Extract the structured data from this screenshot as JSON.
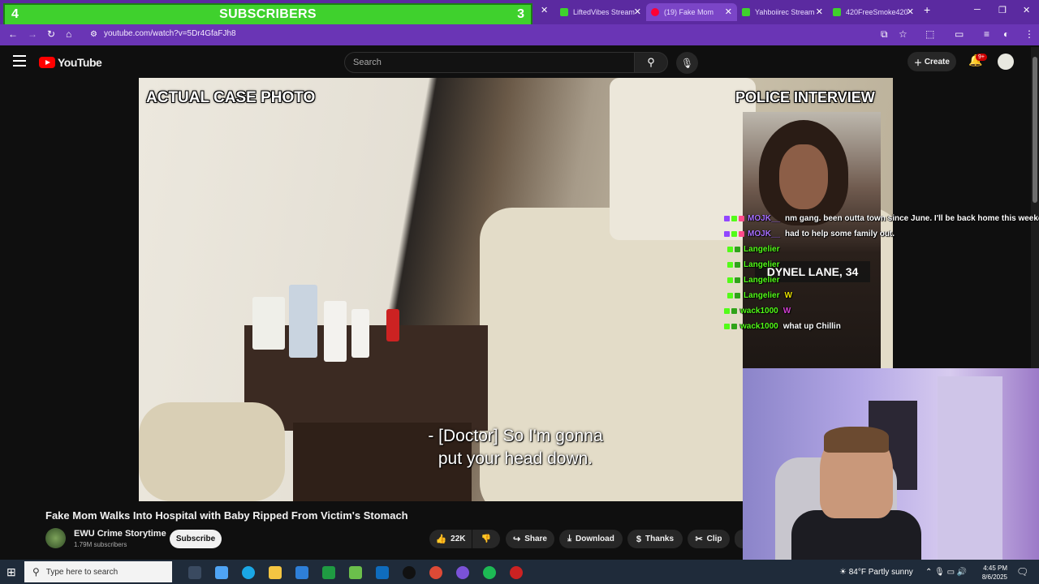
{
  "subscriber_bar": {
    "left_count": "4",
    "label": "SUBSCRIBERS",
    "right_count": "3"
  },
  "tabs": [
    {
      "title": "LiftedVibes Stream",
      "color": "#3fd12d"
    },
    {
      "title": "(19) Fake Mom",
      "color": "#ff0033"
    },
    {
      "title": "Yahboiirec Stream",
      "color": "#3fd12d"
    },
    {
      "title": "420FreeSmoke420",
      "color": "#3fd12d"
    }
  ],
  "browser": {
    "url": "youtube.com/watch?v=5Dr4GfaFJh8",
    "new_tab": "+"
  },
  "youtube": {
    "logo_text": "YouTube",
    "search_placeholder": "Search",
    "create_label": "Create",
    "notif_badge": "9+"
  },
  "video": {
    "left_label": "ACTUAL CASE PHOTO",
    "right_label": "POLICE INTERVIEW",
    "name_card": "DYNEL LANE, 34",
    "subtitle_line1": "- [Doctor] So I'm gonna",
    "subtitle_line2": "put your head down."
  },
  "chat": [
    {
      "user": "MOJK__",
      "msg": "nm gang. been outta town since June. I'll be back home this weekend",
      "color": "#a970ff"
    },
    {
      "user": "MOJK__",
      "msg": "had to help some family out.",
      "color": "#a970ff"
    },
    {
      "user": "Langelier",
      "msg": "",
      "color": "#53fc18"
    },
    {
      "user": "Langelier",
      "msg": "",
      "color": "#53fc18"
    },
    {
      "user": "Langelier",
      "msg": "",
      "color": "#53fc18"
    },
    {
      "user": "Langelier",
      "msg": "W",
      "color": "#53fc18"
    },
    {
      "user": "wack1000",
      "msg": "W",
      "color": "#53fc18"
    },
    {
      "user": "wack1000",
      "msg": "what up Chillin",
      "color": "#53fc18"
    }
  ],
  "watch": {
    "title": "Fake Mom Walks Into Hospital with Baby Ripped From Victim's Stomach",
    "channel": "EWU Crime Storytime",
    "subs": "1.79M subscribers",
    "subscribe_label": "Subscribe",
    "likes": "22K",
    "share_label": "Share",
    "download_label": "Download",
    "thanks_label": "Thanks",
    "clip_label": "Clip"
  },
  "taskbar": {
    "search_placeholder": "Type here to search",
    "weather": "84°F  Partly sunny",
    "time": "4:45 PM",
    "date": "8/6/2025"
  }
}
